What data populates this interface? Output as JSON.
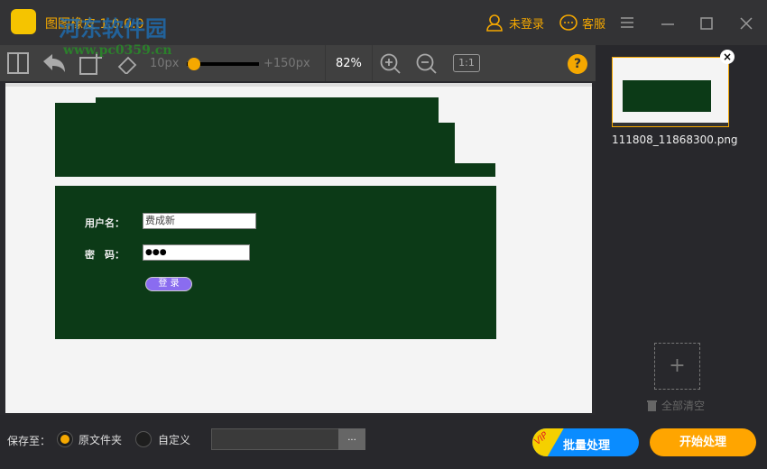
{
  "app": {
    "title": "图图橡皮 1.0.0.0",
    "watermark_name": "河东软件园",
    "watermark_url": "www.pc0359.cn"
  },
  "header": {
    "login_label": "未登录",
    "service_label": "客服"
  },
  "toolbar": {
    "brush_min": "10px",
    "brush_max": "+150px",
    "brush_value_fraction": 0.05,
    "zoom": "82%",
    "actual_size": "1:1",
    "help": "?"
  },
  "image": {
    "username_label": "用户名：",
    "username_value": "费成新",
    "password_label": "密　码：",
    "password_value": "●●●",
    "login_button": "登 录"
  },
  "sidebar": {
    "files": [
      {
        "name": "111808_11868300.png"
      }
    ],
    "clear_all": "全部清空"
  },
  "bottom": {
    "save_to": "保存至：",
    "option_original": "原文件夹",
    "option_custom": "自定义",
    "browse": "...",
    "batch_button": "批量处理",
    "vip_badge": "VIP",
    "start_button": "开始处理"
  },
  "colors": {
    "accent": "#f5a800",
    "blue": "#0a8cff",
    "green": "#0c3a17"
  }
}
